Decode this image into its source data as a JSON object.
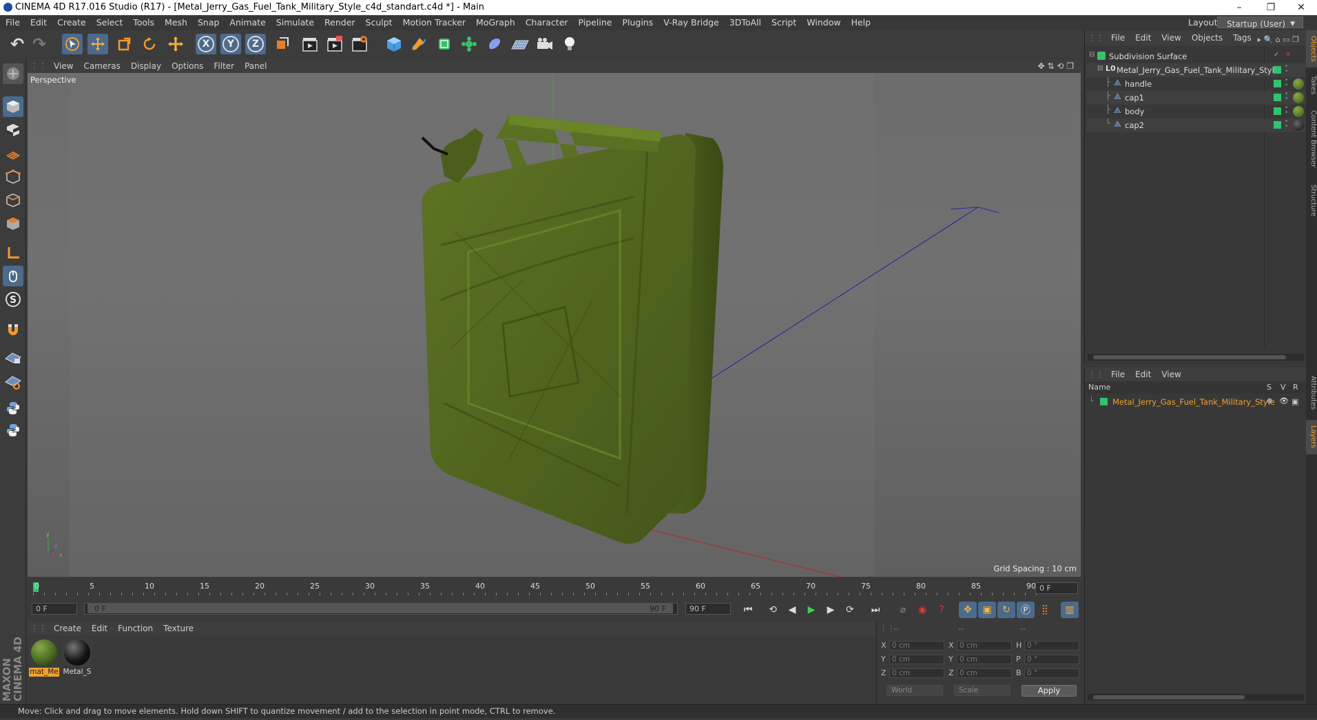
{
  "window": {
    "title": "CINEMA 4D R17.016 Studio (R17) - [Metal_Jerry_Gas_Fuel_Tank_Military_Style_c4d_standart.c4d *] - Main",
    "minimize": "–",
    "maximize": "❐",
    "close": "✕"
  },
  "menu": [
    "File",
    "Edit",
    "Create",
    "Select",
    "Tools",
    "Mesh",
    "Snap",
    "Animate",
    "Simulate",
    "Render",
    "Sculpt",
    "Motion Tracker",
    "MoGraph",
    "Character",
    "Pipeline",
    "Plugins",
    "V-Ray Bridge",
    "3DToAll",
    "Script",
    "Window",
    "Help"
  ],
  "layout": {
    "label": "Layout:",
    "value": "Startup (User)"
  },
  "toolbar": {
    "undo": "↶",
    "redo": "↷",
    "x_axis": "X",
    "y_axis": "Y",
    "z_axis": "Z"
  },
  "viewport": {
    "menu": [
      "View",
      "Cameras",
      "Display",
      "Options",
      "Filter",
      "Panel"
    ],
    "label": "Perspective",
    "grid_spacing": "Grid Spacing : 10 cm"
  },
  "timeline": {
    "ticks": [
      "0",
      "5",
      "10",
      "15",
      "20",
      "25",
      "30",
      "35",
      "40",
      "45",
      "50",
      "55",
      "60",
      "65",
      "70",
      "75",
      "80",
      "85",
      "90"
    ],
    "current_frame": "0 F",
    "start_field": "0 F",
    "range_start": "0 F",
    "range_end": "90 F",
    "end_field": "90 F"
  },
  "materials": {
    "menu": [
      "Create",
      "Edit",
      "Function",
      "Texture"
    ],
    "items": [
      {
        "label": "mat_Me",
        "color": "#4a6a20",
        "selected": true
      },
      {
        "label": "Metal_S",
        "color": "#151515",
        "selected": false
      }
    ]
  },
  "coordinates": {
    "header": [
      "--",
      "--",
      "--"
    ],
    "rows": [
      {
        "a": "X",
        "av": "0 cm",
        "b": "X",
        "bv": "0 cm",
        "c": "H",
        "cv": "0 °"
      },
      {
        "a": "Y",
        "av": "0 cm",
        "b": "Y",
        "bv": "0 cm",
        "c": "P",
        "cv": "0 °"
      },
      {
        "a": "Z",
        "av": "0 cm",
        "b": "Z",
        "bv": "0 cm",
        "c": "B",
        "cv": "0 °"
      }
    ],
    "mode": "World",
    "scale": "Scale",
    "apply": "Apply"
  },
  "object_manager": {
    "menu": [
      "File",
      "Edit",
      "View",
      "Objects",
      "Tags"
    ],
    "objects": [
      {
        "name": "Subdivision Surface"
      },
      {
        "name": "Metal_Jerry_Gas_Fuel_Tank_Military_Style"
      },
      {
        "name": "handle"
      },
      {
        "name": "cap1"
      },
      {
        "name": "body"
      },
      {
        "name": "cap2"
      }
    ]
  },
  "layer_manager": {
    "menu": [
      "File",
      "Edit",
      "View"
    ],
    "columns": {
      "name": "Name",
      "s": "S",
      "v": "V",
      "r": "R"
    },
    "layers": [
      {
        "name": "Metal_Jerry_Gas_Fuel_Tank_Military_Style",
        "color": "#2fc46d"
      }
    ]
  },
  "right_tabs": [
    "Objects",
    "Takes",
    "Content Browser",
    "Structure",
    "Attributes",
    "Layers"
  ],
  "brand": "MAXON CINEMA 4D",
  "status": "Move: Click and drag to move elements. Hold down SHIFT to quantize movement / add to the selection in point mode, CTRL to remove.",
  "colors": {
    "accent": "#4c6a8c",
    "selection": "#f0a030",
    "layer_green": "#2fc46d",
    "tank_green": "#556b1f"
  }
}
